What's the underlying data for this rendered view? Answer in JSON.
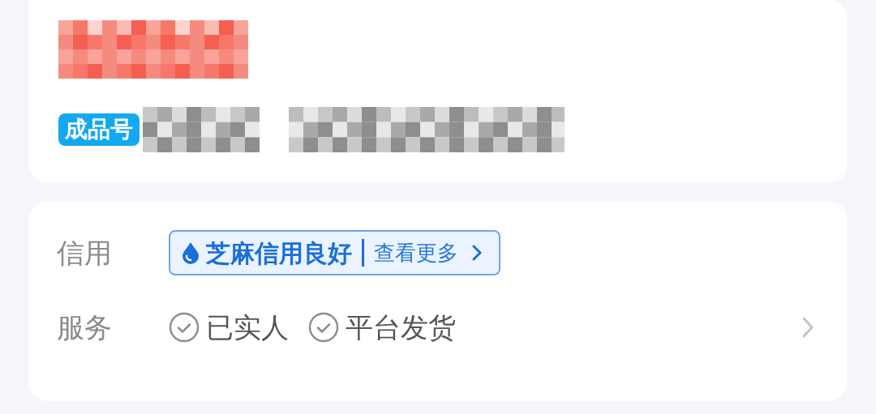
{
  "product": {
    "tag": "成品号"
  },
  "info_rows": [
    {
      "kind": "credit",
      "label": "信用",
      "credit": {
        "rating": "芝麻信用良好",
        "link": "查看更多"
      }
    },
    {
      "kind": "services",
      "label": "服务",
      "services": [
        "已实人",
        "平台发货"
      ]
    }
  ]
}
